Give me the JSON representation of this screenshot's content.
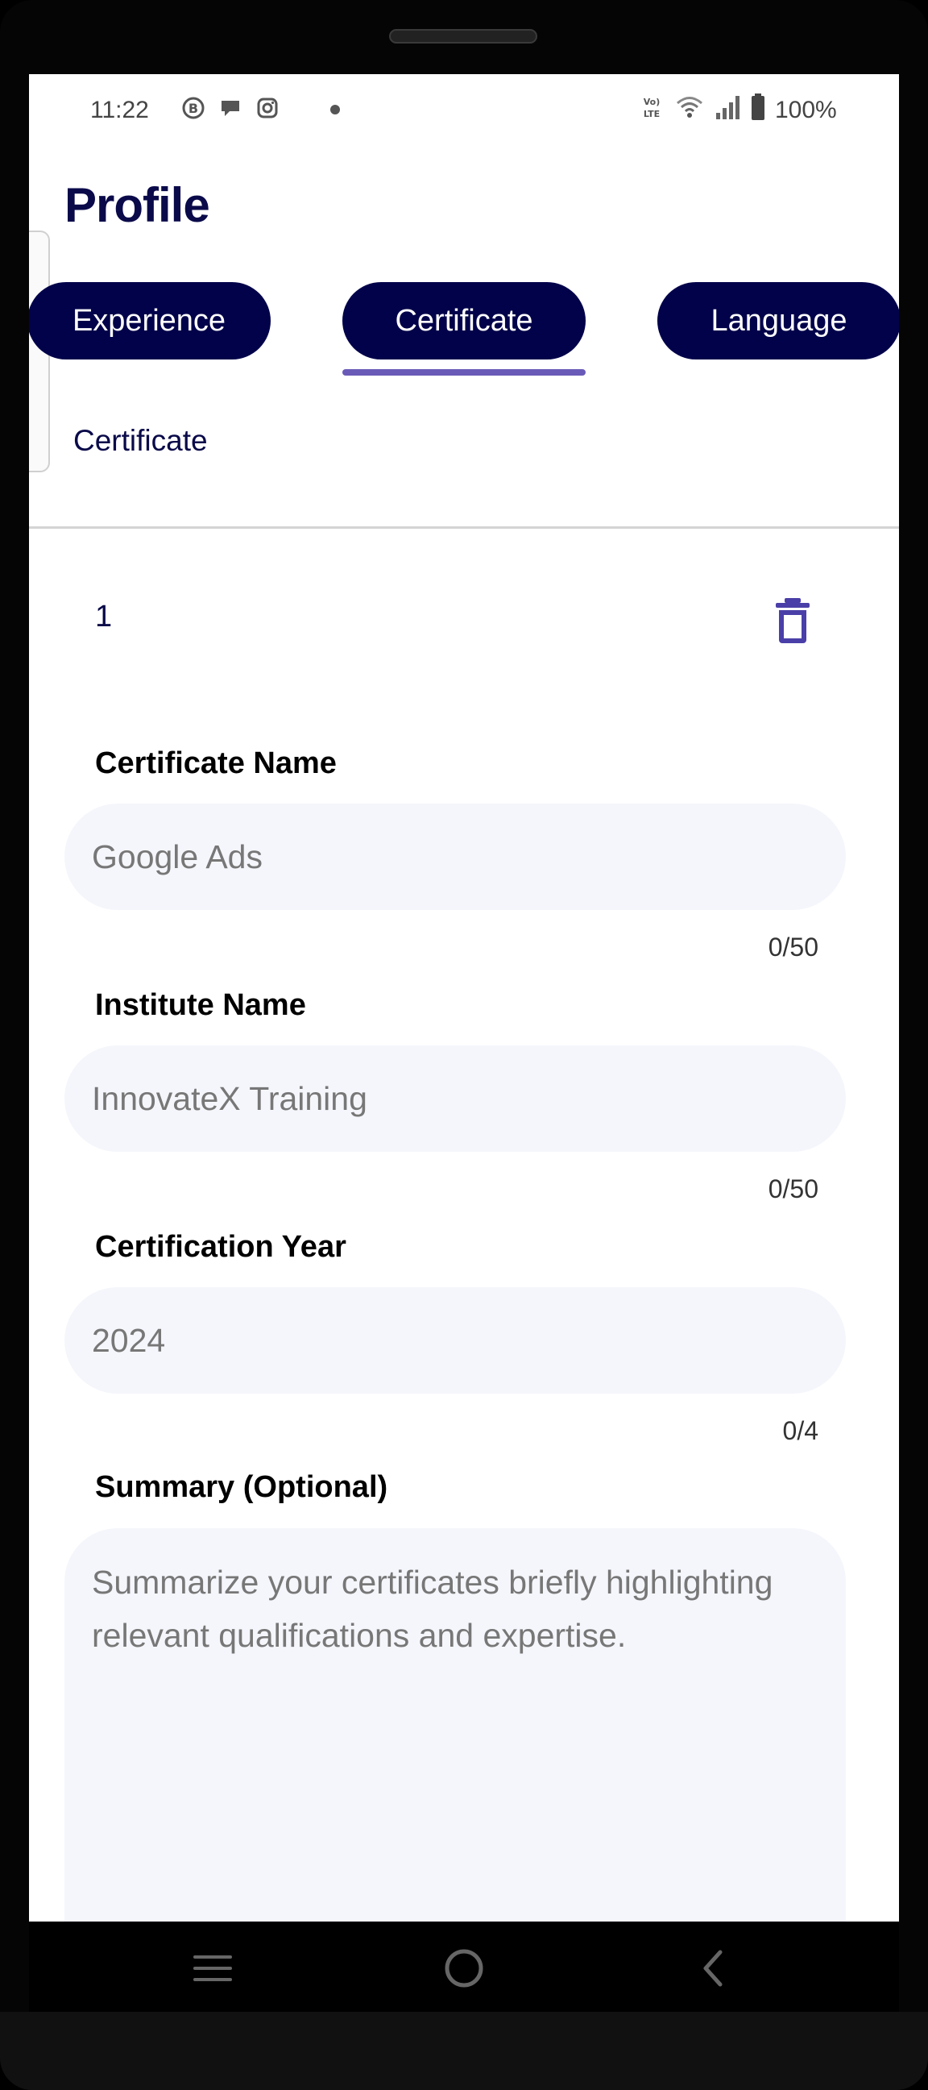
{
  "status_bar": {
    "time": "11:22",
    "icons_left": [
      "b-badge-icon",
      "chat-bubble-icon",
      "instagram-icon",
      "dot-icon"
    ],
    "icons_right": [
      "volte-icon",
      "wifi-icon",
      "signal-icon",
      "battery-icon"
    ],
    "volte_label": "Vo) LTE",
    "battery_percent": "100%"
  },
  "header": {
    "title": "Profile"
  },
  "tabs": [
    {
      "label": "Experience",
      "selected": false
    },
    {
      "label": "Certificate",
      "selected": true
    },
    {
      "label": "Language",
      "selected": false
    }
  ],
  "section": {
    "title": "Certificate"
  },
  "entry": {
    "index": "1",
    "fields": {
      "certificate_name": {
        "label": "Certificate Name",
        "placeholder": "Google Ads",
        "counter": "0/50"
      },
      "institute_name": {
        "label": "Institute Name",
        "placeholder": "InnovateX Training",
        "counter": "0/50"
      },
      "certification_year": {
        "label": "Certification Year",
        "placeholder": "2024",
        "counter": "0/4"
      },
      "summary": {
        "label": "Summary (Optional)",
        "placeholder": "Summarize your certificates briefly highlighting relevant qualifications and expertise."
      }
    }
  },
  "colors": {
    "primary": "#02024a",
    "accent": "#6a5ab8",
    "delete_icon": "#4a3fa8",
    "field_bg": "#f5f6fb"
  },
  "nav_bar": {
    "icons": [
      "menu-icon",
      "home-icon",
      "back-icon"
    ]
  }
}
